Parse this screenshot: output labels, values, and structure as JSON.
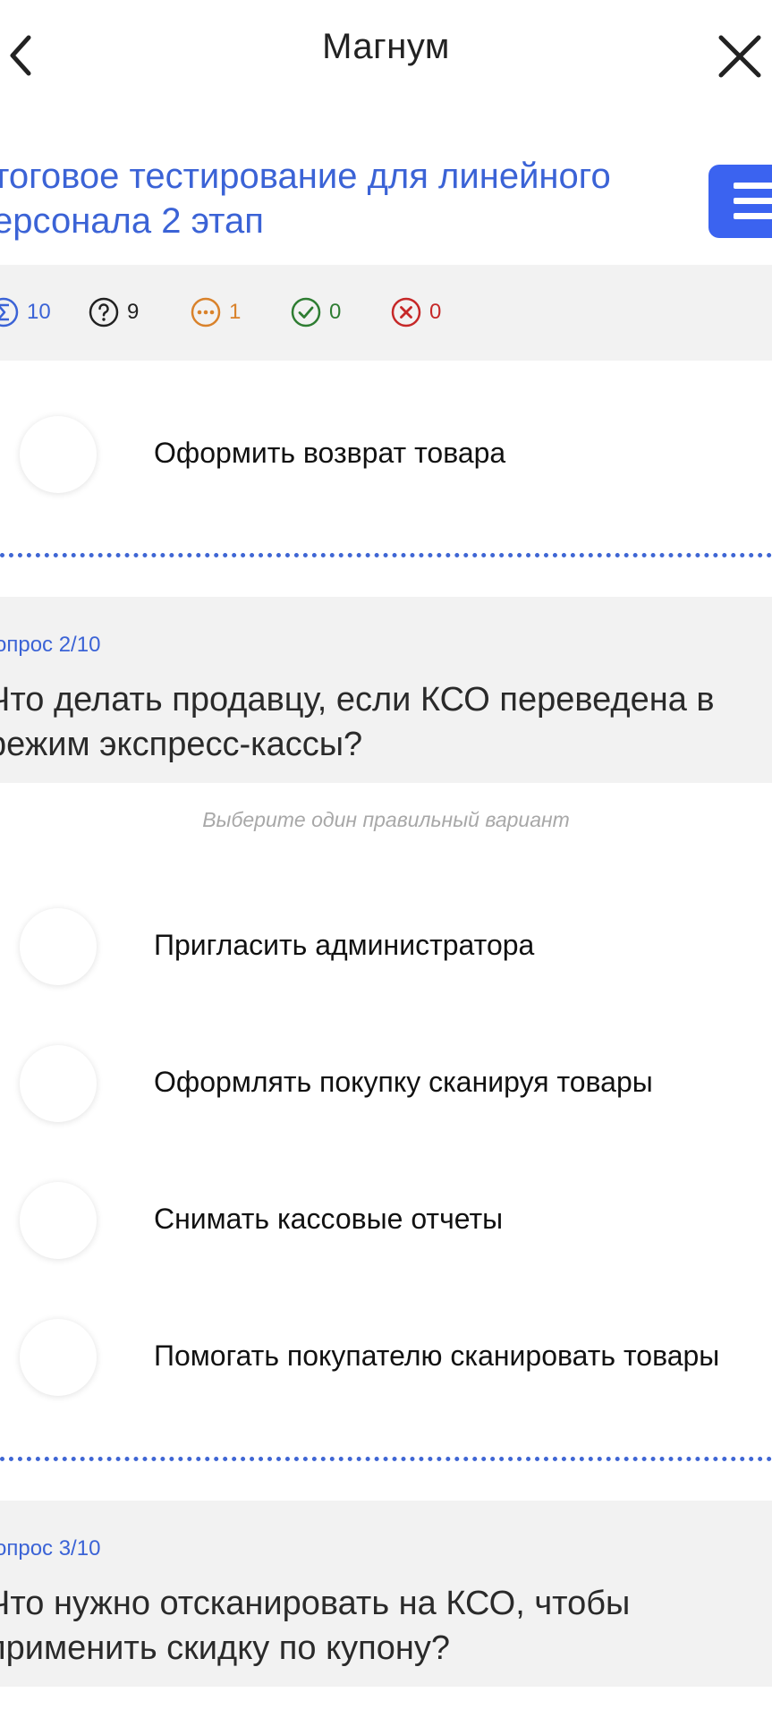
{
  "header": {
    "title": "Магнум"
  },
  "test": {
    "title": "тоговое тестирование для линейного\nерсонала 2 этап"
  },
  "stats": {
    "total": "10",
    "unanswered": "9",
    "in_progress": "1",
    "correct": "0",
    "wrong": "0"
  },
  "colors": {
    "accent": "#3b63f0",
    "total": "#3b63d6",
    "unanswered": "#222222",
    "in_progress": "#d9822b",
    "correct": "#2e7d32",
    "wrong": "#c62828"
  },
  "question1": {
    "options": [
      "Оформить возврат товара"
    ]
  },
  "question2": {
    "number": "опрос 2/10",
    "text": "Что делать продавцу, если КСО переведена в\nрежим экспресс-кассы?",
    "hint": "Выберите один правильный вариант",
    "options": [
      "Пригласить администратора",
      "Оформлять покупку сканируя товары",
      "Снимать кассовые отчеты",
      "Помогать покупателю сканировать товары"
    ]
  },
  "question3": {
    "number": "опрос 3/10",
    "text": "Что нужно отсканировать на КСО, чтобы\nприменить скидку по купону?"
  }
}
